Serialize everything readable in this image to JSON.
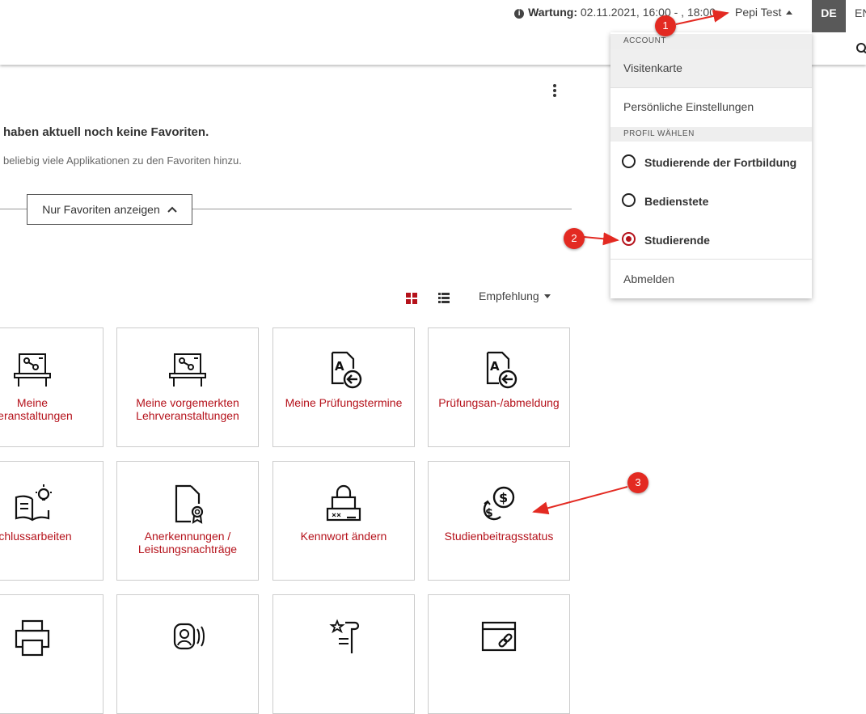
{
  "topbar": {
    "maintenance_label": "Wartung:",
    "maintenance_value": "02.11.2021, 16:00 - , 18:00",
    "user_name": "Pepi Test",
    "lang_de": "DE",
    "lang_en": "EN"
  },
  "favorites": {
    "title": "haben aktuell noch keine Favoriten.",
    "subtitle": "beliebig viele Applikationen zu den Favoriten hinzu.",
    "toggle_label": "Nur Favoriten anzeigen"
  },
  "toolbar": {
    "sort_label": "Empfehlung"
  },
  "tiles": [
    {
      "label_line1": "Meine",
      "label_line2": "veranstaltungen",
      "icon": "lecture-board-icon"
    },
    {
      "label_line1": "Meine vorgemerkten",
      "label_line2": "Lehrveranstaltungen",
      "icon": "lecture-board-icon"
    },
    {
      "label_line1": "Meine Prüfungstermine",
      "label_line2": "",
      "icon": "exam-document-icon"
    },
    {
      "label_line1": "Prüfungsan-/abmeldung",
      "label_line2": "",
      "icon": "exam-document-icon"
    },
    {
      "label_line1": "schlussarbeiten",
      "label_line2": "",
      "icon": "book-idea-icon"
    },
    {
      "label_line1": "Anerkennungen /",
      "label_line2": "Leistungsnachträge",
      "icon": "certificate-document-icon"
    },
    {
      "label_line1": "Kennwort ändern",
      "label_line2": "",
      "icon": "password-lock-icon"
    },
    {
      "label_line1": "Studienbeitragsstatus",
      "label_line2": "",
      "icon": "coins-exchange-icon"
    }
  ],
  "account_menu": {
    "header_account": "ACCOUNT",
    "item_card": "Visitenkarte",
    "item_settings": "Persönliche Einstellungen",
    "header_profile": "PROFIL WÄHLEN",
    "profile_1": "Studierende der Fortbildung",
    "profile_2": "Bedienstete",
    "profile_3": "Studierende",
    "selected_profile": "Studierende",
    "item_logout": "Abmelden"
  },
  "annotations": {
    "badge_1": "1",
    "badge_2": "2",
    "badge_3": "3",
    "color": "#e32a22"
  },
  "colors": {
    "accent": "#b5121b",
    "lang_active_bg": "#595959"
  }
}
